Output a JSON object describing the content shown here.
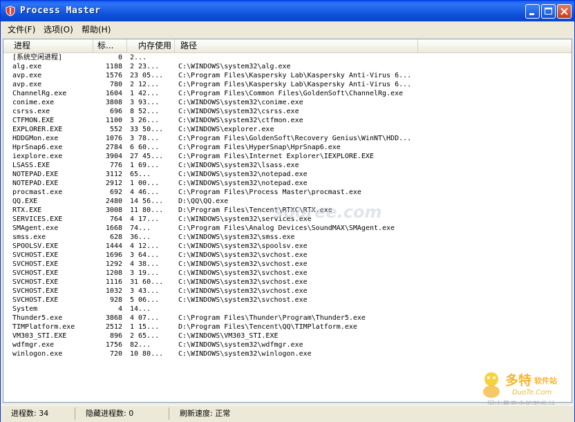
{
  "window": {
    "title": "Process Master"
  },
  "menu": [
    {
      "label": "文件(F)"
    },
    {
      "label": "选项(O)"
    },
    {
      "label": "帮助(H)"
    }
  ],
  "columns": [
    "进程",
    "标...",
    "内存使用",
    "路径"
  ],
  "rows": [
    {
      "name": "[系统空闲进程]",
      "pid": "0",
      "mem": "2...",
      "path": ""
    },
    {
      "name": "alg.exe",
      "pid": "1188",
      "mem": "2 23...",
      "path": "C:\\WINDOWS\\system32\\alg.exe"
    },
    {
      "name": "avp.exe",
      "pid": "1576",
      "mem": "23 05...",
      "path": "C:\\Program Files\\Kaspersky Lab\\Kaspersky Anti-Virus 6..."
    },
    {
      "name": "avp.exe",
      "pid": "780",
      "mem": "2 12...",
      "path": "C:\\Program Files\\Kaspersky Lab\\Kaspersky Anti-Virus 6..."
    },
    {
      "name": "ChannelRg.exe",
      "pid": "1604",
      "mem": "1 42...",
      "path": "C:\\Program Files\\Common Files\\GoldenSoft\\ChannelRg.exe"
    },
    {
      "name": "conime.exe",
      "pid": "3808",
      "mem": "3 93...",
      "path": "C:\\WINDOWS\\system32\\conime.exe"
    },
    {
      "name": "csrss.exe",
      "pid": "696",
      "mem": "8 52...",
      "path": "C:\\WINDOWS\\system32\\csrss.exe"
    },
    {
      "name": "CTFMON.EXE",
      "pid": "1100",
      "mem": "3 26...",
      "path": "C:\\WINDOWS\\system32\\ctfmon.exe"
    },
    {
      "name": "EXPLORER.EXE",
      "pid": "552",
      "mem": "33 50...",
      "path": "C:\\WINDOWS\\explorer.exe"
    },
    {
      "name": "HDDGMon.exe",
      "pid": "1076",
      "mem": "3 78...",
      "path": "C:\\Program Files\\GoldenSoft\\Recovery Genius\\WinNT\\HDD..."
    },
    {
      "name": "HprSnap6.exe",
      "pid": "2784",
      "mem": "6 60...",
      "path": "C:\\Program Files\\HyperSnap\\HprSnap6.exe"
    },
    {
      "name": "iexplore.exe",
      "pid": "3904",
      "mem": "27 45...",
      "path": "C:\\Program Files\\Internet Explorer\\IEXPLORE.EXE"
    },
    {
      "name": "LSASS.EXE",
      "pid": "776",
      "mem": "1 69...",
      "path": "C:\\WINDOWS\\system32\\lsass.exe"
    },
    {
      "name": "NOTEPAD.EXE",
      "pid": "3112",
      "mem": "65...",
      "path": "C:\\WINDOWS\\system32\\notepad.exe"
    },
    {
      "name": "NOTEPAD.EXE",
      "pid": "2912",
      "mem": "1 00...",
      "path": "C:\\WINDOWS\\system32\\notepad.exe"
    },
    {
      "name": "procmast.exe",
      "pid": "692",
      "mem": "4 46...",
      "path": "C:\\Program Files\\Process Master\\procmast.exe"
    },
    {
      "name": "QQ.EXE",
      "pid": "2480",
      "mem": "14 56...",
      "path": "D:\\QQ\\QQ.exe"
    },
    {
      "name": "RTX.EXE",
      "pid": "3008",
      "mem": "11 80...",
      "path": "D:\\Program Files\\Tencent\\RTXC\\RTX.exe"
    },
    {
      "name": "SERVICES.EXE",
      "pid": "764",
      "mem": "4 17...",
      "path": "C:\\WINDOWS\\system32\\services.exe"
    },
    {
      "name": "SMAgent.exe",
      "pid": "1668",
      "mem": "74...",
      "path": "C:\\Program Files\\Analog Devices\\SoundMAX\\SMAgent.exe"
    },
    {
      "name": "smss.exe",
      "pid": "628",
      "mem": "36...",
      "path": "C:\\WINDOWS\\system32\\smss.exe"
    },
    {
      "name": "SPOOLSV.EXE",
      "pid": "1444",
      "mem": "4 12...",
      "path": "C:\\WINDOWS\\system32\\spoolsv.exe"
    },
    {
      "name": "SVCHOST.EXE",
      "pid": "1696",
      "mem": "3 64...",
      "path": "C:\\WINDOWS\\system32\\svchost.exe"
    },
    {
      "name": "SVCHOST.EXE",
      "pid": "1292",
      "mem": "4 38...",
      "path": "C:\\WINDOWS\\system32\\svchost.exe"
    },
    {
      "name": "SVCHOST.EXE",
      "pid": "1208",
      "mem": "3 19...",
      "path": "C:\\WINDOWS\\system32\\svchost.exe"
    },
    {
      "name": "SVCHOST.EXE",
      "pid": "1116",
      "mem": "31 60...",
      "path": "C:\\WINDOWS\\system32\\svchost.exe"
    },
    {
      "name": "SVCHOST.EXE",
      "pid": "1032",
      "mem": "3 43...",
      "path": "C:\\WINDOWS\\system32\\svchost.exe"
    },
    {
      "name": "SVCHOST.EXE",
      "pid": "928",
      "mem": "5 06...",
      "path": "C:\\WINDOWS\\system32\\svchost.exe"
    },
    {
      "name": "System",
      "pid": "4",
      "mem": "14...",
      "path": ""
    },
    {
      "name": "Thunder5.exe",
      "pid": "3868",
      "mem": "4 07...",
      "path": "C:\\Program Files\\Thunder\\Program\\Thunder5.exe"
    },
    {
      "name": "TIMPlatform.exe",
      "pid": "2512",
      "mem": "1 15...",
      "path": "D:\\Program Files\\Tencent\\QQ\\TIMPlatform.exe"
    },
    {
      "name": "VM303_STI.EXE",
      "pid": "896",
      "mem": "2 65...",
      "path": "C:\\WINDOWS\\VM303_STI.EXE"
    },
    {
      "name": "wdfmgr.exe",
      "pid": "1756",
      "mem": "82...",
      "path": "C:\\WINDOWS\\system32\\wdfmgr.exe"
    },
    {
      "name": "winlogon.exe",
      "pid": "720",
      "mem": "10 80...",
      "path": "C:\\WINDOWS\\system32\\winlogon.exe"
    }
  ],
  "status": {
    "process_count": "进程数: 34",
    "hidden_count": "隐藏进程数: 0",
    "refresh_speed": "刷新速度: 正常"
  },
  "watermark": {
    "center": "sooree.com",
    "brand": "多特",
    "brand_suffix": "软件站",
    "site": "DuoTe.Com",
    "slogan": "国内最安全的软件站"
  },
  "colors": {
    "titlebar": "#0a5ef0",
    "close_button": "#c7391b",
    "watermark_orange": "#f2a400"
  }
}
